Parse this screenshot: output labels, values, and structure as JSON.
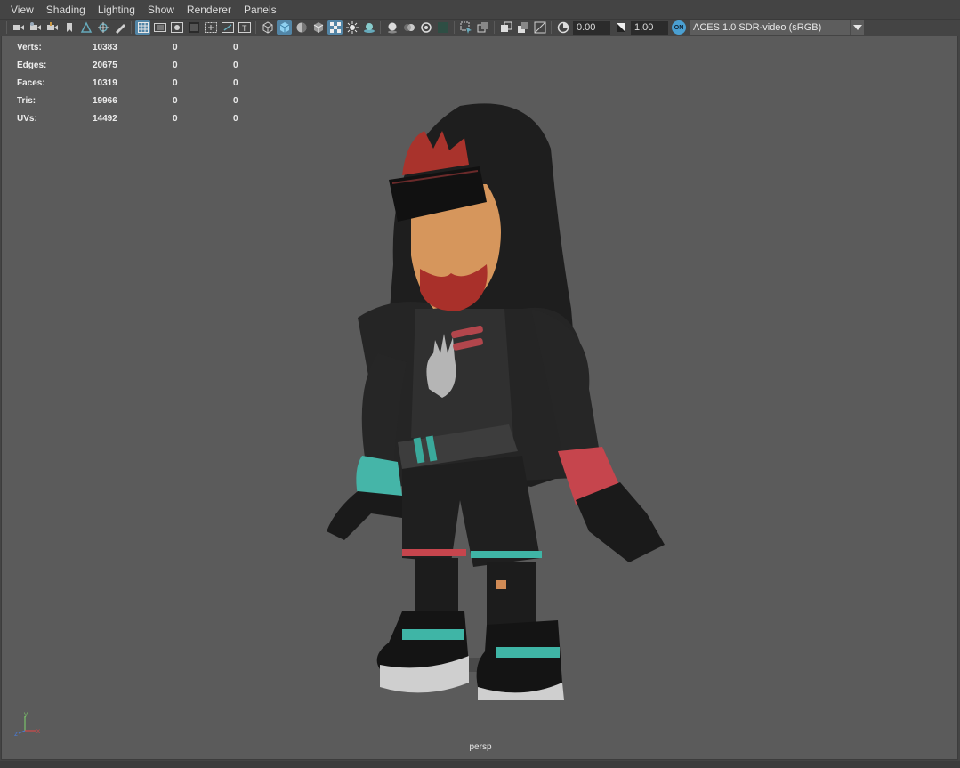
{
  "menu": [
    "View",
    "Shading",
    "Lighting",
    "Show",
    "Renderer",
    "Panels"
  ],
  "toolbar": {
    "exposure_value": "0.00",
    "gamma_value": "1.00",
    "color_space_badge": "ON",
    "color_space": "ACES 1.0 SDR-video (sRGB)"
  },
  "hud": {
    "rows": [
      {
        "label": "Verts:",
        "total": "10383",
        "selected": "0",
        "tri": "0"
      },
      {
        "label": "Edges:",
        "total": "20675",
        "selected": "0",
        "tri": "0"
      },
      {
        "label": "Faces:",
        "total": "10319",
        "selected": "0",
        "tri": "0"
      },
      {
        "label": "Tris:",
        "total": "19966",
        "selected": "0",
        "tri": "0"
      },
      {
        "label": "UVs:",
        "total": "14492",
        "selected": "0",
        "tri": "0"
      }
    ]
  },
  "viewport": {
    "camera_label": "persp",
    "axis": {
      "y": "y",
      "z": "z",
      "x": "x"
    }
  },
  "colors": {
    "accent": "#5285a6",
    "viewport_bg": "#5b5b5b",
    "teal": "#4fc4b5",
    "red": "#c8404a"
  }
}
